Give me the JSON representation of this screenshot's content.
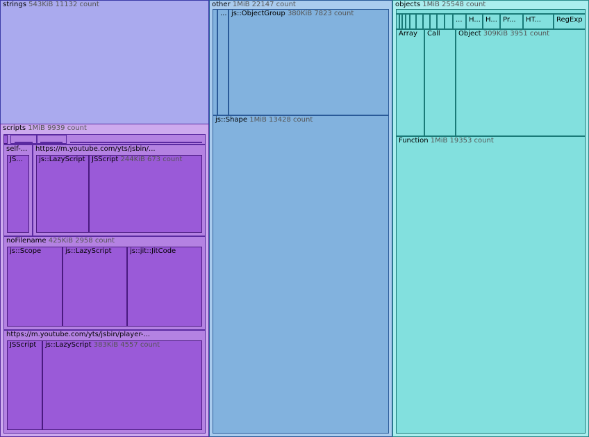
{
  "nodes": {
    "strings": {
      "name": "strings",
      "meta": "543KiB 11132 count"
    },
    "scripts": {
      "name": "scripts",
      "meta": "1MiB 9939 count"
    },
    "self": {
      "name": "self-...",
      "meta": ""
    },
    "self_js": {
      "name": "JS...",
      "meta": ""
    },
    "yt1": {
      "name": "https://m.youtube.com/yts/jsbin/...",
      "meta": ""
    },
    "yt1_lazy": {
      "name": "js::LazyScript",
      "meta": ""
    },
    "yt1_js": {
      "name": "JSScript",
      "meta": "244KiB 673 count"
    },
    "nofile": {
      "name": "noFilename",
      "meta": "425KiB 2958 count"
    },
    "nf_scope": {
      "name": "js::Scope",
      "meta": ""
    },
    "nf_lazy": {
      "name": "js::LazyScript",
      "meta": ""
    },
    "nf_jit": {
      "name": "js::jit::JitCode",
      "meta": ""
    },
    "yt2": {
      "name": "https://m.youtube.com/yts/jsbin/player-...",
      "meta": ""
    },
    "yt2_js": {
      "name": "JSScript",
      "meta": ""
    },
    "yt2_lazy": {
      "name": "js::LazyScript",
      "meta": "383KiB 4557 count"
    },
    "other": {
      "name": "other",
      "meta": "1MiB 22147 count"
    },
    "oth_dots": {
      "name": "...",
      "meta": ""
    },
    "oth_og": {
      "name": "js::ObjectGroup",
      "meta": "380KiB 7823 count"
    },
    "oth_shape": {
      "name": "js::Shape",
      "meta": "1MiB 13428 count"
    },
    "objects": {
      "name": "objects",
      "meta": "1MiB 25548 count"
    },
    "obj_dots": {
      "name": "...",
      "meta": ""
    },
    "obj_h1": {
      "name": "H...",
      "meta": ""
    },
    "obj_h2": {
      "name": "H...",
      "meta": ""
    },
    "obj_pr": {
      "name": "Pr...",
      "meta": ""
    },
    "obj_ht": {
      "name": "HT...",
      "meta": ""
    },
    "obj_re": {
      "name": "RegExp",
      "meta": ""
    },
    "obj_arr": {
      "name": "Array",
      "meta": ""
    },
    "obj_call": {
      "name": "Call",
      "meta": ""
    },
    "obj_obj": {
      "name": "Object",
      "meta": "309KiB 3951 count"
    },
    "obj_fn": {
      "name": "Function",
      "meta": "1MiB 19353 count"
    }
  }
}
